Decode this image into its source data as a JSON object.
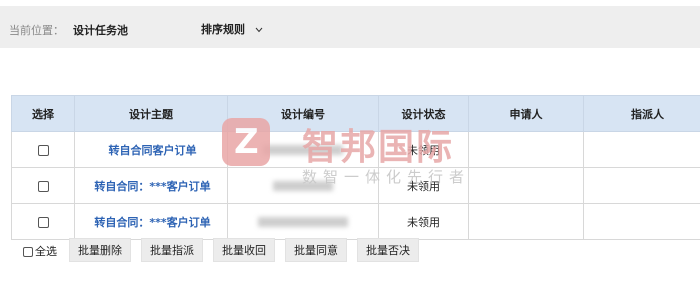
{
  "breadcrumb": {
    "label": "当前位置：",
    "current": "设计任务池"
  },
  "sort": {
    "label": "排序规则"
  },
  "table": {
    "headers": [
      "选择",
      "设计主题",
      "设计编号",
      "设计状态",
      "申请人",
      "指派人"
    ],
    "rows": [
      {
        "topic": "转自合同客户订单",
        "status": "未领用"
      },
      {
        "topic": "转自合同：***客户订单",
        "status": "未领用"
      },
      {
        "topic": "转自合同：***客户订单",
        "status": "未领用"
      }
    ]
  },
  "footer": {
    "select_all": "全选",
    "buttons": [
      "批量删除",
      "批量指派",
      "批量收回",
      "批量同意",
      "批量否决"
    ]
  },
  "watermark": {
    "logo": "Z",
    "title": "智邦国际",
    "slogan": "数智一体化先行者"
  },
  "colors": {
    "header_bg": "#d7e4f3",
    "link": "#2d63b4",
    "watermark": "#e7a7a7"
  }
}
